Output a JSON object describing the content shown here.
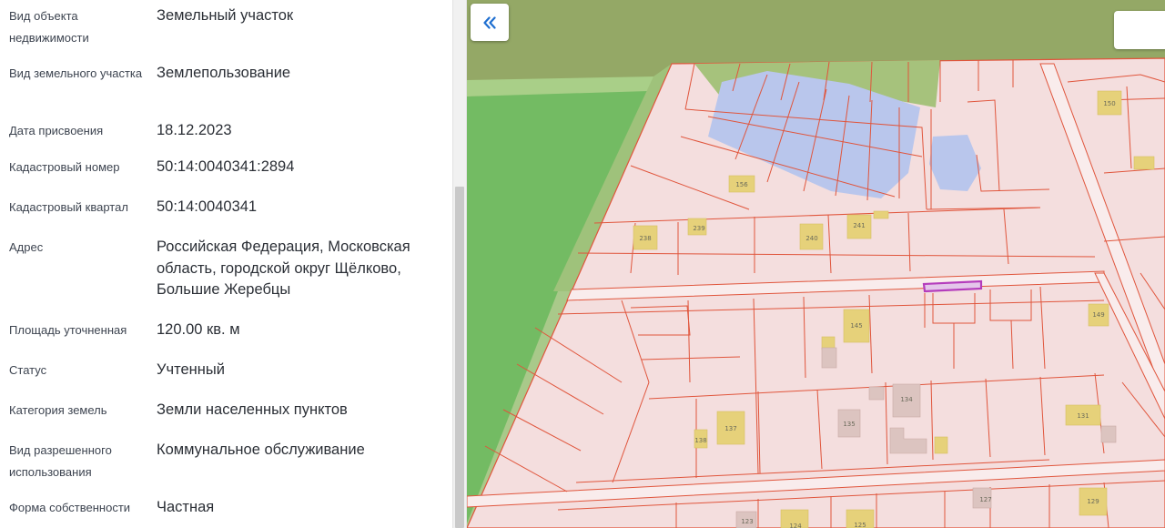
{
  "properties": [
    {
      "label": "Вид объекта недвижимости",
      "value": "Земельный участок"
    },
    {
      "label": "Вид земельного участка",
      "value": "Землепользование"
    },
    {
      "label": "Дата присвоения",
      "value": "18.12.2023"
    },
    {
      "label": "Кадастровый номер",
      "value": "50:14:0040341:2894"
    },
    {
      "label": "Кадастровый квартал",
      "value": "50:14:0040341"
    },
    {
      "label": "Адрес",
      "value": "Российская Федерация, Московская область, городской округ Щёлково, Большие Жеребцы"
    },
    {
      "label": "Площадь уточненная",
      "value": "120.00 кв. м"
    },
    {
      "label": "Статус",
      "value": "Учтенный"
    },
    {
      "label": "Категория земель",
      "value": "Земли населенных пунктов"
    },
    {
      "label": "Вид разрешенного использования",
      "value": "Коммунальное обслуживание"
    },
    {
      "label": "Форма собственности",
      "value": "Частная"
    }
  ],
  "map": {
    "collapse_icon": "double-chevron-left-icon",
    "colors": {
      "forest": "#94a866",
      "grass": "#73bb63",
      "parcel_fill": "#f4dede",
      "boundary": "#e0553c",
      "water": "#b9c6ec",
      "building": "#e6d17a",
      "selected": "#b43cbc"
    },
    "parcel_labels": [
      "150",
      "156",
      "238",
      "239",
      "240",
      "241",
      "145",
      "149",
      "134",
      "135",
      "137",
      "138",
      "131",
      "127",
      "129",
      "123",
      "124",
      "125"
    ]
  }
}
